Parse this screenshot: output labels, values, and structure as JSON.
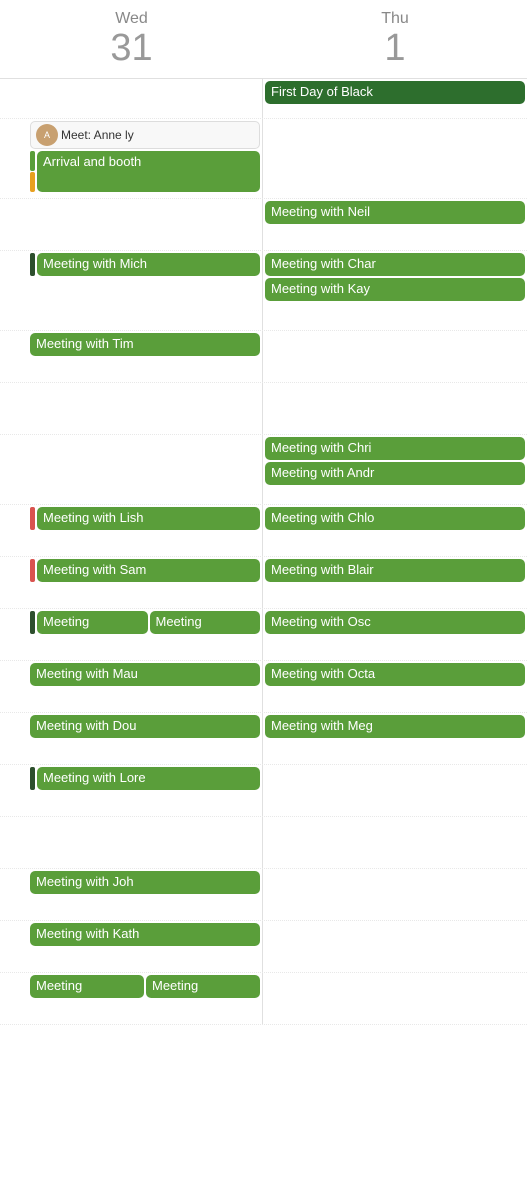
{
  "header": {
    "col1": {
      "day": "Wed",
      "date": "31"
    },
    "col2": {
      "day": "Thu",
      "date": "1"
    }
  },
  "colors": {
    "green": "#5a9e3a",
    "darkGreen": "#2d6e2d",
    "red": "#d9534f",
    "gray": "#a0a0a0"
  },
  "rows": [
    {
      "id": "row0",
      "left": [],
      "right": [
        {
          "text": "First Day of Black",
          "type": "dark-green",
          "full": true
        }
      ]
    },
    {
      "id": "row1",
      "left": [
        {
          "text": "Meet: Anne ly",
          "type": "meet-anne"
        },
        {
          "text": "Arrival and booth",
          "type": "green",
          "full": true
        }
      ],
      "right": []
    },
    {
      "id": "row2",
      "left": [],
      "right": [
        {
          "text": "Meeting with Neil",
          "type": "green",
          "full": true
        }
      ]
    },
    {
      "id": "row3",
      "left": [
        {
          "text": "Meeting with Mich",
          "type": "green",
          "full": true
        }
      ],
      "right": [
        {
          "text": "Meeting with Char",
          "type": "green",
          "full": true
        },
        {
          "text": "Meeting with Kay",
          "type": "green",
          "full": true
        }
      ]
    },
    {
      "id": "row4",
      "left": [
        {
          "text": "Meeting with Tim",
          "type": "green",
          "full": true
        }
      ],
      "right": []
    },
    {
      "id": "row5",
      "left": [],
      "right": []
    },
    {
      "id": "row6",
      "left": [],
      "right": [
        {
          "text": "Meeting with Chri",
          "type": "green",
          "full": true
        },
        {
          "text": "Meeting with Andr",
          "type": "green",
          "full": true
        }
      ]
    },
    {
      "id": "row7",
      "left": [
        {
          "text": "Meeting with Lish",
          "type": "green",
          "full": true
        }
      ],
      "right": [
        {
          "text": "Meeting with Chlo",
          "type": "green",
          "full": true
        }
      ]
    },
    {
      "id": "row8",
      "left": [
        {
          "text": "Meeting with Sam",
          "type": "green",
          "full": true
        }
      ],
      "right": [
        {
          "text": "Meeting with Blair",
          "type": "green",
          "full": true
        }
      ]
    },
    {
      "id": "row9",
      "left": [
        {
          "text": "Meeting",
          "type": "green",
          "half": true
        },
        {
          "text": "Meeting",
          "type": "green",
          "half": true
        }
      ],
      "right": [
        {
          "text": "Meeting with Osc",
          "type": "green",
          "full": true
        }
      ]
    },
    {
      "id": "row10",
      "left": [
        {
          "text": "Meeting with Mau",
          "type": "green",
          "full": true
        }
      ],
      "right": [
        {
          "text": "Meeting with Octa",
          "type": "green",
          "full": true
        }
      ]
    },
    {
      "id": "row11",
      "left": [
        {
          "text": "Meeting with Dou",
          "type": "green",
          "full": true
        }
      ],
      "right": [
        {
          "text": "Meeting with Meg",
          "type": "green",
          "full": true
        }
      ]
    },
    {
      "id": "row12",
      "left": [
        {
          "text": "Meeting with Lore",
          "type": "green",
          "full": true
        }
      ],
      "right": []
    },
    {
      "id": "row13",
      "left": [],
      "right": []
    },
    {
      "id": "row14",
      "left": [
        {
          "text": "Meeting with Joh",
          "type": "green",
          "full": true
        }
      ],
      "right": []
    },
    {
      "id": "row15",
      "left": [
        {
          "text": "Meeting with Kath",
          "type": "green",
          "full": true
        }
      ],
      "right": []
    },
    {
      "id": "row16",
      "left": [
        {
          "text": "Meeting",
          "type": "green",
          "half": true
        },
        {
          "text": "Meeting",
          "type": "green",
          "half": true
        }
      ],
      "right": []
    }
  ],
  "side_bars": {
    "row1_left": [
      "green",
      "orange"
    ],
    "row3_left": [
      "dark"
    ],
    "row7_left": [
      "red"
    ],
    "row8_left": [
      "red"
    ],
    "row9_left": [
      "dark"
    ],
    "row12_left": [
      "dark"
    ]
  }
}
